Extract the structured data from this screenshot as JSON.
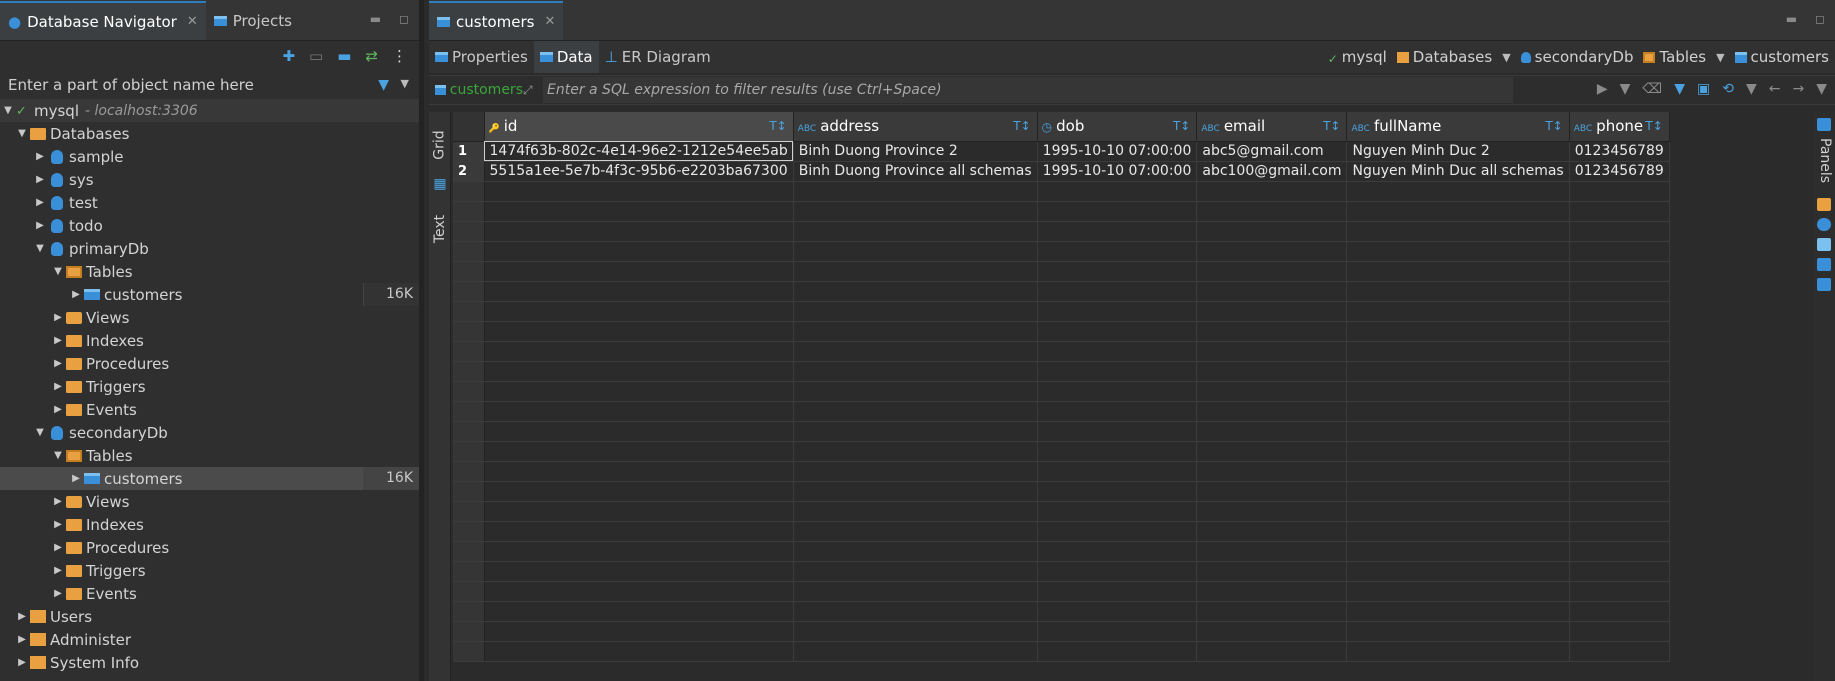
{
  "left_pane": {
    "tabs": [
      {
        "label": "Database Navigator",
        "active": true
      },
      {
        "label": "Projects",
        "active": false
      }
    ],
    "filter_placeholder": "Enter a part of object name here",
    "tree": {
      "connection": {
        "name": "mysql",
        "host": "- localhost:3306"
      },
      "databases_label": "Databases",
      "schemas": [
        "sample",
        "sys",
        "test",
        "todo"
      ],
      "primary": {
        "name": "primaryDb",
        "tables_label": "Tables",
        "table": {
          "name": "customers",
          "size": "16K"
        },
        "folders": [
          "Views",
          "Indexes",
          "Procedures",
          "Triggers",
          "Events"
        ]
      },
      "secondary": {
        "name": "secondaryDb",
        "tables_label": "Tables",
        "table": {
          "name": "customers",
          "size": "16K"
        },
        "folders": [
          "Views",
          "Indexes",
          "Procedures",
          "Triggers",
          "Events"
        ]
      },
      "bottom_items": [
        "Users",
        "Administer",
        "System Info"
      ]
    }
  },
  "editor": {
    "tab_label": "customers",
    "subtabs": [
      "Properties",
      "Data",
      "ER Diagram"
    ],
    "active_subtab": "Data",
    "breadcrumbs": [
      "mysql",
      "Databases",
      "secondaryDb",
      "Tables",
      "customers"
    ],
    "filter": {
      "table_label": "customers",
      "placeholder": "Enter a SQL expression to filter results (use Ctrl+Space)"
    },
    "side_tabs": [
      "Grid",
      "Text"
    ],
    "panels_label": "Panels",
    "grid": {
      "columns": [
        "id",
        "address",
        "dob",
        "email",
        "fullName",
        "phone"
      ],
      "rows": [
        {
          "n": "1",
          "cells": [
            "1474f63b-802c-4e14-96e2-1212e54ee5ab",
            "Binh Duong Province 2",
            "1995-10-10 07:00:00",
            "abc5@gmail.com",
            "Nguyen Minh Duc 2",
            "0123456789"
          ]
        },
        {
          "n": "2",
          "cells": [
            "5515a1ee-5e7b-4f3c-95b6-e2203ba67300",
            "Binh Duong Province all schemas",
            "1995-10-10 07:00:00",
            "abc100@gmail.com",
            "Nguyen Minh Duc all schemas",
            "0123456789"
          ]
        }
      ]
    }
  },
  "colors": {
    "accent": "#3a8fd9",
    "folder": "#e8a040",
    "background": "#2b2b2b"
  }
}
